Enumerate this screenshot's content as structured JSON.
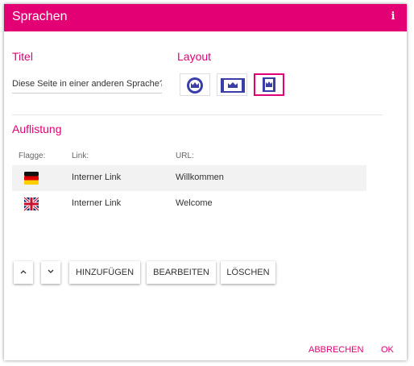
{
  "dialog": {
    "title": "Sprachen",
    "info_icon": "info-icon",
    "accent_color": "#e20074"
  },
  "titel": {
    "heading": "Titel",
    "value": "Diese Seite in einer anderen Sprache?"
  },
  "layout": {
    "heading": "Layout",
    "options": [
      {
        "icon": "crown-circle-icon",
        "selected": false
      },
      {
        "icon": "crown-banner-icon",
        "selected": false
      },
      {
        "icon": "crown-flag-icon",
        "selected": true
      }
    ]
  },
  "auflistung": {
    "heading": "Auflistung",
    "columns": [
      "Flagge:",
      "Link:",
      "URL:"
    ],
    "rows": [
      {
        "flag": "germany-flag-icon",
        "link": "Interner Link",
        "url": "Willkommen"
      },
      {
        "flag": "uk-flag-icon",
        "link": "Interner Link",
        "url": "Welcome"
      }
    ]
  },
  "toolbar": {
    "up_icon": "chevron-up-icon",
    "down_icon": "chevron-down-icon",
    "add_label": "HINZUFÜGEN",
    "edit_label": "BEARBEITEN",
    "delete_label": "LÖSCHEN"
  },
  "footer": {
    "cancel_label": "ABBRECHEN",
    "ok_label": "OK"
  }
}
